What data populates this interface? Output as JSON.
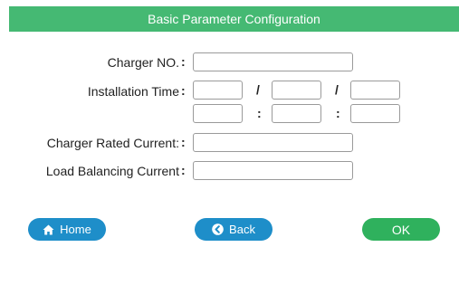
{
  "header": {
    "title": "Basic Parameter Configuration"
  },
  "form": {
    "charger_no": {
      "label": "Charger NO.",
      "colon": ":",
      "value": ""
    },
    "installation_time": {
      "label": "Installation Time",
      "colon": ":",
      "date_separator": "/",
      "time_separator": ":",
      "year": "",
      "month": "",
      "day": "",
      "hour": "",
      "minute": "",
      "second": ""
    },
    "rated_current": {
      "label": "Charger Rated Current:",
      "colon": ":",
      "value": ""
    },
    "load_balancing": {
      "label": "Load Balancing Current",
      "colon": ":",
      "value": ""
    }
  },
  "buttons": {
    "home_label": "Home",
    "back_label": "Back",
    "ok_label": "OK"
  },
  "colors": {
    "header_bg": "#45b973",
    "blue_button": "#1e8ec9",
    "green_button": "#2fb15d"
  },
  "icons": {
    "home": "home-icon",
    "back": "back-arrow-icon"
  }
}
